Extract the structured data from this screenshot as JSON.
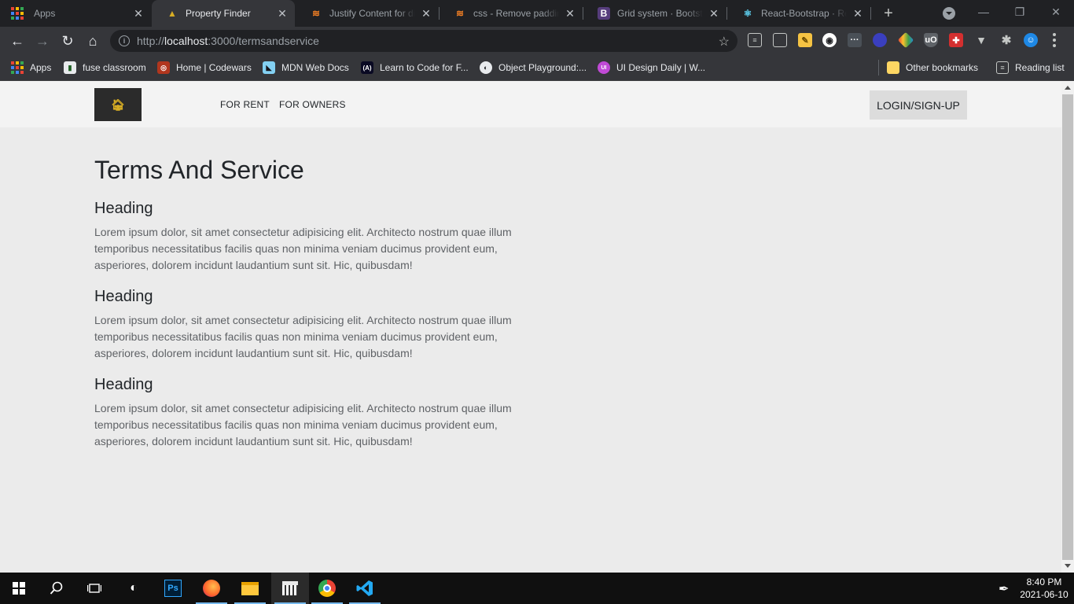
{
  "browser": {
    "tabs": [
      {
        "title": "Apps",
        "favicon": "apps-grid-icon",
        "active": false
      },
      {
        "title": "Property Finder",
        "favicon": "site-logo-icon",
        "active": true
      },
      {
        "title": "Justify Content for diff",
        "favicon": "stackoverflow-icon",
        "active": false
      },
      {
        "title": "css - Remove padding",
        "favicon": "stackoverflow-icon",
        "active": false
      },
      {
        "title": "Grid system · Bootstrap",
        "favicon": "bootstrap-icon",
        "active": false
      },
      {
        "title": "React-Bootstrap · React",
        "favicon": "react-bootstrap-icon",
        "active": false
      }
    ],
    "address": {
      "protocol": "http://",
      "host": "localhost",
      "rest": ":3000/termsandservice"
    },
    "bookmarks": [
      {
        "label": "Apps",
        "icon": "apps-grid-icon"
      },
      {
        "label": "fuse classroom",
        "icon": "fuse-icon"
      },
      {
        "label": "Home | Codewars",
        "icon": "codewars-icon"
      },
      {
        "label": "MDN Web Docs",
        "icon": "mdn-icon"
      },
      {
        "label": "Learn to Code for F...",
        "icon": "freecodecamp-icon"
      },
      {
        "label": "Object Playground:...",
        "icon": "globe-icon"
      },
      {
        "label": "UI Design Daily | W...",
        "icon": "uidesign-icon"
      },
      {
        "label": "Other bookmarks",
        "icon": "folder-icon"
      },
      {
        "label": "Reading list",
        "icon": "reading-list-icon"
      }
    ]
  },
  "site": {
    "nav": {
      "links": [
        "FOR RENT",
        "FOR OWNERS"
      ],
      "login_label": "LOGIN/SIGN-UP"
    },
    "title": "Terms And Service",
    "sections": [
      {
        "heading": "Heading",
        "body": "Lorem ipsum dolor, sit amet consectetur adipisicing elit. Architecto nostrum quae illum temporibus necessitatibus facilis quas non minima veniam ducimus provident eum, asperiores, dolorem incidunt laudantium sunt sit. Hic, quibusdam!"
      },
      {
        "heading": "Heading",
        "body": "Lorem ipsum dolor, sit amet consectetur adipisicing elit. Architecto nostrum quae illum temporibus necessitatibus facilis quas non minima veniam ducimus provident eum, asperiores, dolorem incidunt laudantium sunt sit. Hic, quibusdam!"
      },
      {
        "heading": "Heading",
        "body": "Lorem ipsum dolor, sit amet consectetur adipisicing elit. Architecto nostrum quae illum temporibus necessitatibus facilis quas non minima veniam ducimus provident eum, asperiores, dolorem incidunt laudantium sunt sit. Hic, quibusdam!"
      }
    ]
  },
  "taskbar": {
    "time": "8:40 PM",
    "date": "2021-06-10"
  },
  "colors": {
    "page_background": "#ebebeb",
    "nav_background": "#f3f3f3",
    "login_button": "#dcdcdc",
    "logo_background": "#2b2b2b",
    "logo_gold": "#d7ad24"
  }
}
